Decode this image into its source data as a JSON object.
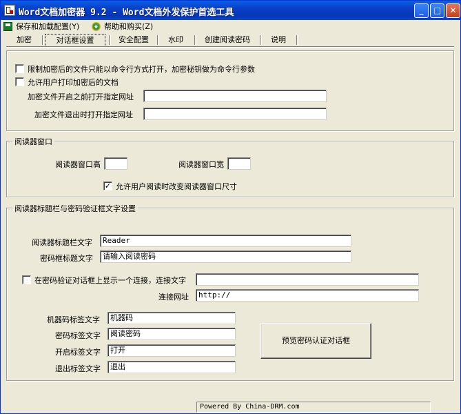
{
  "window": {
    "title": "Word文档加密器 9.2 - Word文档外发保护首选工具",
    "min_glyph": "_",
    "max_glyph": "□",
    "close_glyph": "✕"
  },
  "menu": {
    "save": "保存和加载配置(Y)",
    "help": "帮助和购买(Z)"
  },
  "tabs": [
    "加密",
    "对话框设置",
    "安全配置",
    "水印",
    "创建阅读密码",
    "说明"
  ],
  "options": {
    "restrict_cmdline": "限制加密后的文件只能以命令行方式打开，加密秘钥做为命令行参数",
    "allow_print": "允许用户打印加密后的文档",
    "open_url_label": "加密文件开启之前打开指定网址",
    "open_url_value": "",
    "exit_url_label": "加密文件退出时打开指定网址",
    "exit_url_value": ""
  },
  "reader_window": {
    "title": "阅读器窗口",
    "height_label": "阅读器窗口高",
    "height_value": "",
    "width_label": "阅读器窗口宽",
    "width_value": "",
    "allow_resize": "允许用户阅读时改变阅读器窗口尺寸",
    "allow_resize_checked": "✓"
  },
  "title_settings": {
    "title": "阅读器标题栏与密码验证框文字设置",
    "reader_title_label": "阅读器标题栏文字",
    "reader_title_value": "Reader",
    "pwd_title_label": "密码框标题文字",
    "pwd_title_value": "请输入阅读密码",
    "show_link_label": "在密码验证对话框上显示一个连接，连接文字",
    "show_link_value": "",
    "link_url_label": "连接网址",
    "link_url_value": "http://",
    "machine_code_label": "机器码标签文字",
    "machine_code_value": "机器码",
    "pwd_label_label": "密码标签文字",
    "pwd_label_value": "阅读密码",
    "open_label_label": "开启标签文字",
    "open_label_value": "打开",
    "exit_label_label": "退出标签文字",
    "exit_label_value": "退出",
    "preview_button": "预览密码认证对话框"
  },
  "status": {
    "text": "Powered By China-DRM.com"
  }
}
